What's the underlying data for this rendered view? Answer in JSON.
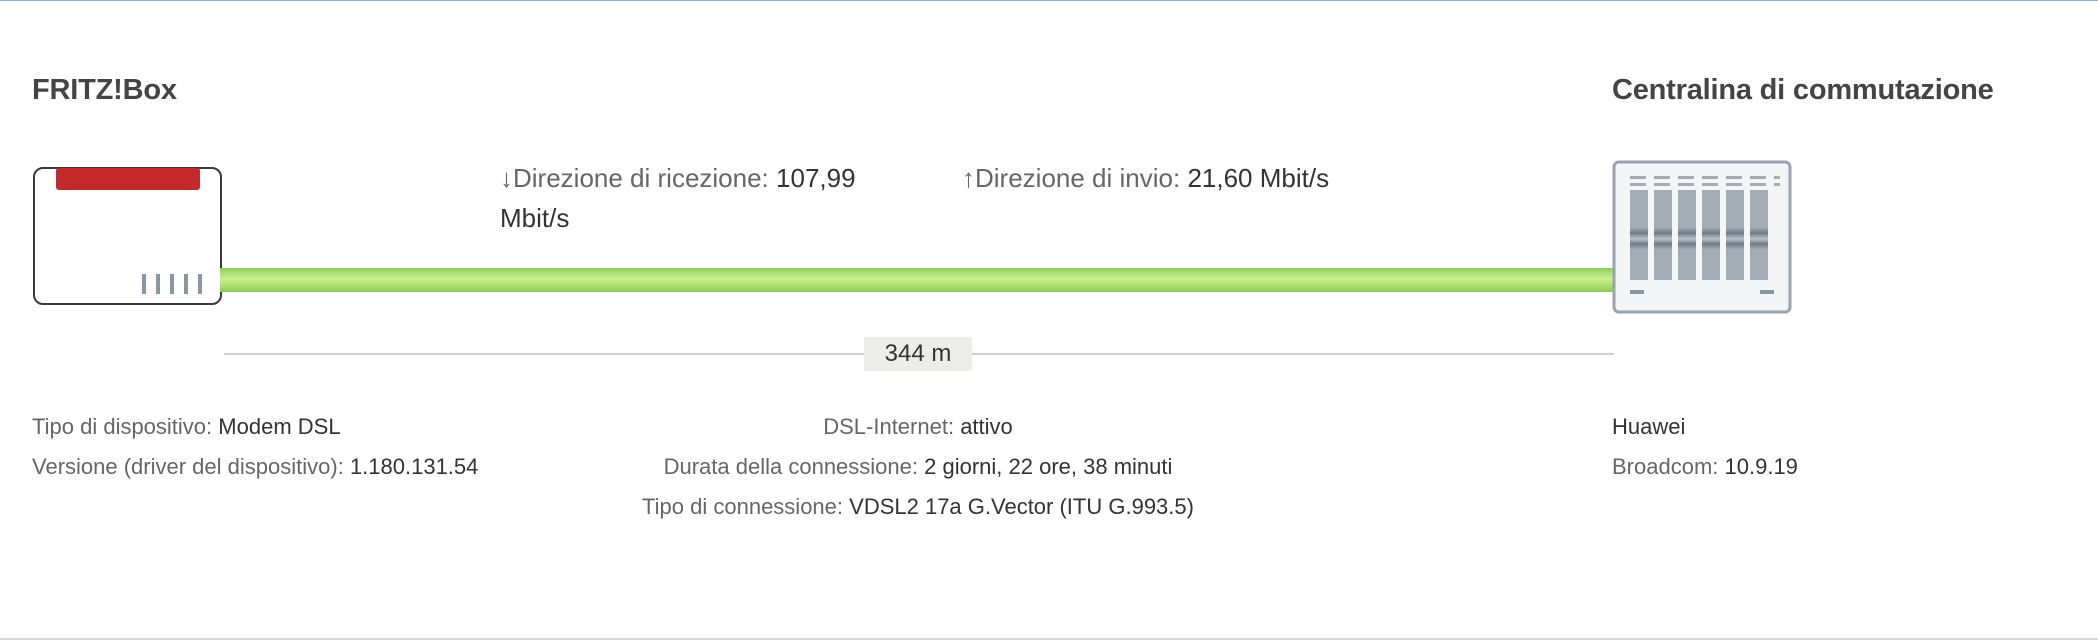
{
  "fritzbox": {
    "title": "FRITZ!Box",
    "device_type_label": "Tipo di dispositivo:",
    "device_type_value": "Modem DSL",
    "version_label": "Versione (driver del dispositivo):",
    "version_value": "1.180.131.54"
  },
  "exchange": {
    "title": "Centralina di commutazione",
    "vendor": "Huawei",
    "chip_label": "Broadcom:",
    "chip_value": "10.9.19"
  },
  "line": {
    "down_label": "↓Direzione di ricezione:",
    "down_value": "107,99 Mbit/s",
    "up_label": "↑Direzione di invio:",
    "up_value": "21,60 Mbit/s",
    "distance": "344 m",
    "status_color": "#a9e06c"
  },
  "connection": {
    "dsl_label": "DSL-Internet:",
    "dsl_value": "attivo",
    "duration_label": "Durata della connessione:",
    "duration_value": "2 giorni, 22 ore, 38 minuti",
    "type_label": "Tipo di connessione:",
    "type_value": "VDSL2 17a G.Vector (ITU G.993.5)"
  },
  "icons": {
    "router": "fritzbox-router-icon",
    "exchange": "exchange-cabinet-icon"
  }
}
